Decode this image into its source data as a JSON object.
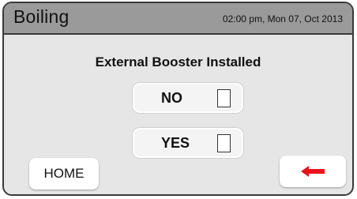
{
  "header": {
    "title": "Boiling",
    "datetime": "02:00 pm, Mon 07, Oct 2013"
  },
  "main": {
    "title": "External Booster Installed",
    "options": [
      {
        "label": "NO",
        "checked": false
      },
      {
        "label": "YES",
        "checked": false
      }
    ]
  },
  "footer": {
    "home_label": "HOME",
    "back_icon": "back-arrow-icon"
  },
  "colors": {
    "header_bg": "#9a9a9a",
    "screen_bg": "#e6e6e6",
    "arrow_red": "#e8141b"
  }
}
